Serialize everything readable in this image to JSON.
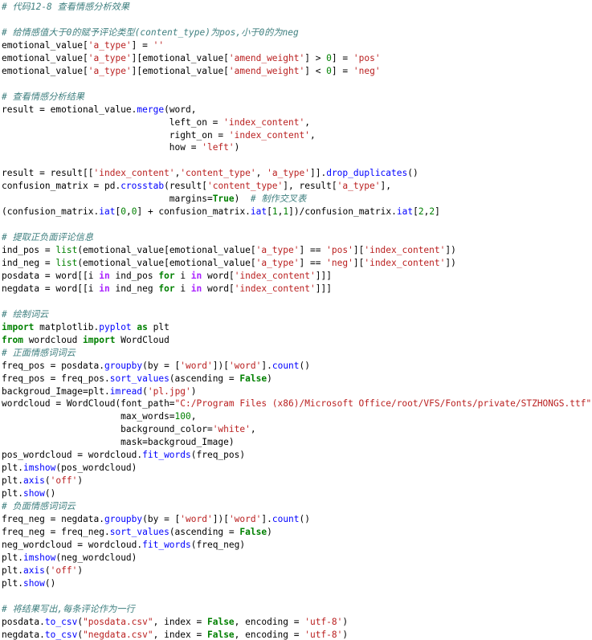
{
  "colors": {
    "background": "#ffffff",
    "plain": "#000000",
    "comment": "#408080",
    "string": "#ba2121",
    "keyword": "#008000",
    "builtin": "#008000",
    "number": "#008000",
    "operator": "#aa22ff",
    "attribute_call": "#0000ff"
  },
  "code": {
    "language": "python",
    "lines": [
      [
        [
          "c",
          "# 代码12-8 查看情感分析效果"
        ]
      ],
      [],
      [
        [
          "c",
          "# 给情感值大于0的赋予评论类型(content_type)为pos,小于0的为neg"
        ]
      ],
      [
        [
          "p",
          "emotional_value["
        ],
        [
          "s",
          "'a_type'"
        ],
        [
          "p",
          "] = "
        ],
        [
          "s",
          "''"
        ]
      ],
      [
        [
          "p",
          "emotional_value["
        ],
        [
          "s",
          "'a_type'"
        ],
        [
          "p",
          "][emotional_value["
        ],
        [
          "s",
          "'amend_weight'"
        ],
        [
          "p",
          "] > "
        ],
        [
          "n",
          "0"
        ],
        [
          "p",
          "] = "
        ],
        [
          "s",
          "'pos'"
        ]
      ],
      [
        [
          "p",
          "emotional_value["
        ],
        [
          "s",
          "'a_type'"
        ],
        [
          "p",
          "][emotional_value["
        ],
        [
          "s",
          "'amend_weight'"
        ],
        [
          "p",
          "] < "
        ],
        [
          "n",
          "0"
        ],
        [
          "p",
          "] = "
        ],
        [
          "s",
          "'neg'"
        ]
      ],
      [],
      [
        [
          "c",
          "# 查看情感分析结果"
        ]
      ],
      [
        [
          "p",
          "result = emotional_value."
        ],
        [
          "f",
          "merge"
        ],
        [
          "p",
          "(word,"
        ]
      ],
      [
        [
          "p",
          "                               left_on = "
        ],
        [
          "s",
          "'index_content'"
        ],
        [
          "p",
          ","
        ]
      ],
      [
        [
          "p",
          "                               right_on = "
        ],
        [
          "s",
          "'index_content'"
        ],
        [
          "p",
          ","
        ]
      ],
      [
        [
          "p",
          "                               how = "
        ],
        [
          "s",
          "'left'"
        ],
        [
          "p",
          ")"
        ]
      ],
      [],
      [
        [
          "p",
          "result = result[["
        ],
        [
          "s",
          "'index_content'"
        ],
        [
          "p",
          ","
        ],
        [
          "s",
          "'content_type'"
        ],
        [
          "p",
          ", "
        ],
        [
          "s",
          "'a_type'"
        ],
        [
          "p",
          "]]."
        ],
        [
          "f",
          "drop_duplicates"
        ],
        [
          "p",
          "()"
        ]
      ],
      [
        [
          "p",
          "confusion_matrix = pd."
        ],
        [
          "f",
          "crosstab"
        ],
        [
          "p",
          "(result["
        ],
        [
          "s",
          "'content_type'"
        ],
        [
          "p",
          "], result["
        ],
        [
          "s",
          "'a_type'"
        ],
        [
          "p",
          "],"
        ]
      ],
      [
        [
          "p",
          "                               margins="
        ],
        [
          "k",
          "True"
        ],
        [
          "p",
          ")  "
        ],
        [
          "c",
          "# 制作交叉表"
        ]
      ],
      [
        [
          "p",
          "(confusion_matrix."
        ],
        [
          "f",
          "iat"
        ],
        [
          "p",
          "["
        ],
        [
          "n",
          "0"
        ],
        [
          "p",
          ","
        ],
        [
          "n",
          "0"
        ],
        [
          "p",
          "] + confusion_matrix."
        ],
        [
          "f",
          "iat"
        ],
        [
          "p",
          "["
        ],
        [
          "n",
          "1"
        ],
        [
          "p",
          ","
        ],
        [
          "n",
          "1"
        ],
        [
          "p",
          "])/confusion_matrix."
        ],
        [
          "f",
          "iat"
        ],
        [
          "p",
          "["
        ],
        [
          "n",
          "2"
        ],
        [
          "p",
          ","
        ],
        [
          "n",
          "2"
        ],
        [
          "p",
          "]"
        ]
      ],
      [],
      [
        [
          "c",
          "# 提取正负面评论信息"
        ]
      ],
      [
        [
          "p",
          "ind_pos = "
        ],
        [
          "b",
          "list"
        ],
        [
          "p",
          "(emotional_value[emotional_value["
        ],
        [
          "s",
          "'a_type'"
        ],
        [
          "p",
          "] == "
        ],
        [
          "s",
          "'pos'"
        ],
        [
          "p",
          "]["
        ],
        [
          "s",
          "'index_content'"
        ],
        [
          "p",
          "])"
        ]
      ],
      [
        [
          "p",
          "ind_neg = "
        ],
        [
          "b",
          "list"
        ],
        [
          "p",
          "(emotional_value[emotional_value["
        ],
        [
          "s",
          "'a_type'"
        ],
        [
          "p",
          "] == "
        ],
        [
          "s",
          "'neg'"
        ],
        [
          "p",
          "]["
        ],
        [
          "s",
          "'index_content'"
        ],
        [
          "p",
          "])"
        ]
      ],
      [
        [
          "p",
          "posdata = word[[i "
        ],
        [
          "o",
          "in"
        ],
        [
          "p",
          " ind_pos "
        ],
        [
          "k",
          "for"
        ],
        [
          "p",
          " i "
        ],
        [
          "o",
          "in"
        ],
        [
          "p",
          " word["
        ],
        [
          "s",
          "'index_content'"
        ],
        [
          "p",
          "]]]"
        ]
      ],
      [
        [
          "p",
          "negdata = word[[i "
        ],
        [
          "o",
          "in"
        ],
        [
          "p",
          " ind_neg "
        ],
        [
          "k",
          "for"
        ],
        [
          "p",
          " i "
        ],
        [
          "o",
          "in"
        ],
        [
          "p",
          " word["
        ],
        [
          "s",
          "'index_content'"
        ],
        [
          "p",
          "]]]"
        ]
      ],
      [],
      [
        [
          "c",
          "# 绘制词云"
        ]
      ],
      [
        [
          "k",
          "import"
        ],
        [
          "p",
          " matplotlib."
        ],
        [
          "f",
          "pyplot"
        ],
        [
          "p",
          " "
        ],
        [
          "k",
          "as"
        ],
        [
          "p",
          " plt"
        ]
      ],
      [
        [
          "k",
          "from"
        ],
        [
          "p",
          " wordcloud "
        ],
        [
          "k",
          "import"
        ],
        [
          "p",
          " WordCloud"
        ]
      ],
      [
        [
          "c",
          "# 正面情感词词云"
        ]
      ],
      [
        [
          "p",
          "freq_pos = posdata."
        ],
        [
          "f",
          "groupby"
        ],
        [
          "p",
          "(by = ["
        ],
        [
          "s",
          "'word'"
        ],
        [
          "p",
          "])["
        ],
        [
          "s",
          "'word'"
        ],
        [
          "p",
          "]."
        ],
        [
          "f",
          "count"
        ],
        [
          "p",
          "()"
        ]
      ],
      [
        [
          "p",
          "freq_pos = freq_pos."
        ],
        [
          "f",
          "sort_values"
        ],
        [
          "p",
          "(ascending = "
        ],
        [
          "k",
          "False"
        ],
        [
          "p",
          ")"
        ]
      ],
      [
        [
          "p",
          "backgroud_Image=plt."
        ],
        [
          "f",
          "imread"
        ],
        [
          "p",
          "("
        ],
        [
          "s",
          "'pl.jpg'"
        ],
        [
          "p",
          ")"
        ]
      ],
      [
        [
          "p",
          "wordcloud = WordCloud(font_path="
        ],
        [
          "s",
          "\"C:/Program Files (x86)/Microsoft Office/root/VFS/Fonts/private/STZHONGS.ttf\""
        ],
        [
          "p",
          ","
        ]
      ],
      [
        [
          "p",
          "                      max_words="
        ],
        [
          "n",
          "100"
        ],
        [
          "p",
          ","
        ]
      ],
      [
        [
          "p",
          "                      background_color="
        ],
        [
          "s",
          "'white'"
        ],
        [
          "p",
          ","
        ]
      ],
      [
        [
          "p",
          "                      mask=backgroud_Image)"
        ]
      ],
      [
        [
          "p",
          "pos_wordcloud = wordcloud."
        ],
        [
          "f",
          "fit_words"
        ],
        [
          "p",
          "(freq_pos)"
        ]
      ],
      [
        [
          "p",
          "plt."
        ],
        [
          "f",
          "imshow"
        ],
        [
          "p",
          "(pos_wordcloud)"
        ]
      ],
      [
        [
          "p",
          "plt."
        ],
        [
          "f",
          "axis"
        ],
        [
          "p",
          "("
        ],
        [
          "s",
          "'off'"
        ],
        [
          "p",
          ")"
        ]
      ],
      [
        [
          "p",
          "plt."
        ],
        [
          "f",
          "show"
        ],
        [
          "p",
          "()"
        ]
      ],
      [
        [
          "c",
          "# 负面情感词词云"
        ]
      ],
      [
        [
          "p",
          "freq_neg = negdata."
        ],
        [
          "f",
          "groupby"
        ],
        [
          "p",
          "(by = ["
        ],
        [
          "s",
          "'word'"
        ],
        [
          "p",
          "])["
        ],
        [
          "s",
          "'word'"
        ],
        [
          "p",
          "]."
        ],
        [
          "f",
          "count"
        ],
        [
          "p",
          "()"
        ]
      ],
      [
        [
          "p",
          "freq_neg = freq_neg."
        ],
        [
          "f",
          "sort_values"
        ],
        [
          "p",
          "(ascending = "
        ],
        [
          "k",
          "False"
        ],
        [
          "p",
          ")"
        ]
      ],
      [
        [
          "p",
          "neg_wordcloud = wordcloud."
        ],
        [
          "f",
          "fit_words"
        ],
        [
          "p",
          "(freq_neg)"
        ]
      ],
      [
        [
          "p",
          "plt."
        ],
        [
          "f",
          "imshow"
        ],
        [
          "p",
          "(neg_wordcloud)"
        ]
      ],
      [
        [
          "p",
          "plt."
        ],
        [
          "f",
          "axis"
        ],
        [
          "p",
          "("
        ],
        [
          "s",
          "'off'"
        ],
        [
          "p",
          ")"
        ]
      ],
      [
        [
          "p",
          "plt."
        ],
        [
          "f",
          "show"
        ],
        [
          "p",
          "()"
        ]
      ],
      [],
      [
        [
          "c",
          "# 将结果写出,每条评论作为一行"
        ]
      ],
      [
        [
          "p",
          "posdata."
        ],
        [
          "f",
          "to_csv"
        ],
        [
          "p",
          "("
        ],
        [
          "s",
          "\"posdata.csv\""
        ],
        [
          "p",
          ", index = "
        ],
        [
          "k",
          "False"
        ],
        [
          "p",
          ", encoding = "
        ],
        [
          "s",
          "'utf-8'"
        ],
        [
          "p",
          ")"
        ]
      ],
      [
        [
          "p",
          "negdata."
        ],
        [
          "f",
          "to_csv"
        ],
        [
          "p",
          "("
        ],
        [
          "s",
          "\"negdata.csv\""
        ],
        [
          "p",
          ", index = "
        ],
        [
          "k",
          "False"
        ],
        [
          "p",
          ", encoding = "
        ],
        [
          "s",
          "'utf-8'"
        ],
        [
          "p",
          ")"
        ]
      ]
    ]
  }
}
